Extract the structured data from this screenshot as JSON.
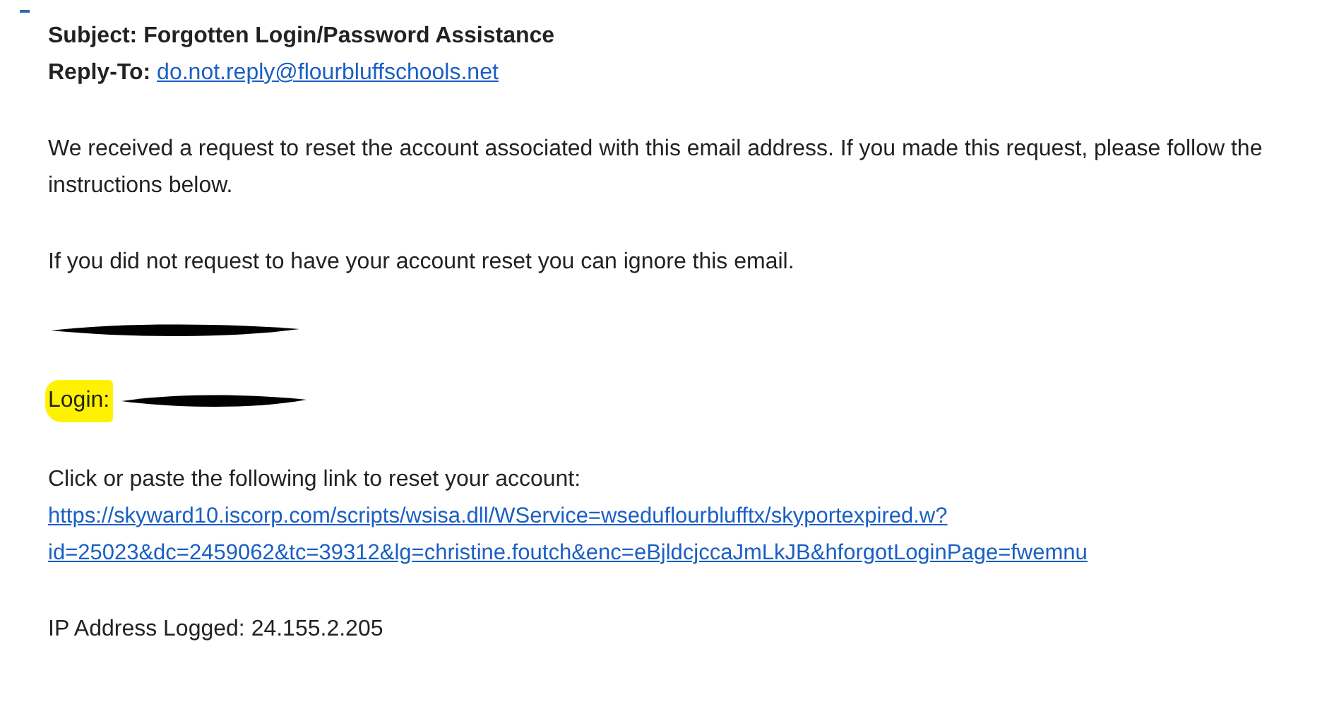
{
  "email": {
    "subject": "Subject: Forgotten Login/Password Assistance",
    "reply_to": {
      "label": "Reply-To:",
      "address": "do.not.reply@flourbluffschools.net"
    },
    "paragraphs": [
      "We received a request to reset the account associated with this email address.  If you made this request, please follow the instructions below.",
      "If you did not request to have your account reset you can ignore this email."
    ],
    "login": {
      "label": "Login:",
      "highlighted": true
    },
    "link_intro": "Click or paste the following link to reset your account:",
    "link_lines": [
      "https://skyward10.iscorp.com/scripts/wsisa.dll/WService=wseduflourblufftx/skyportexpired.w?",
      "id=25023&dc=2459062&tc=39312&lg=christine.foutch&enc=eBjldcjccaJmLkJB&hforgotLoginPage=fwemnu"
    ],
    "ip": "IP Address Logged: 24.155.2.205"
  }
}
